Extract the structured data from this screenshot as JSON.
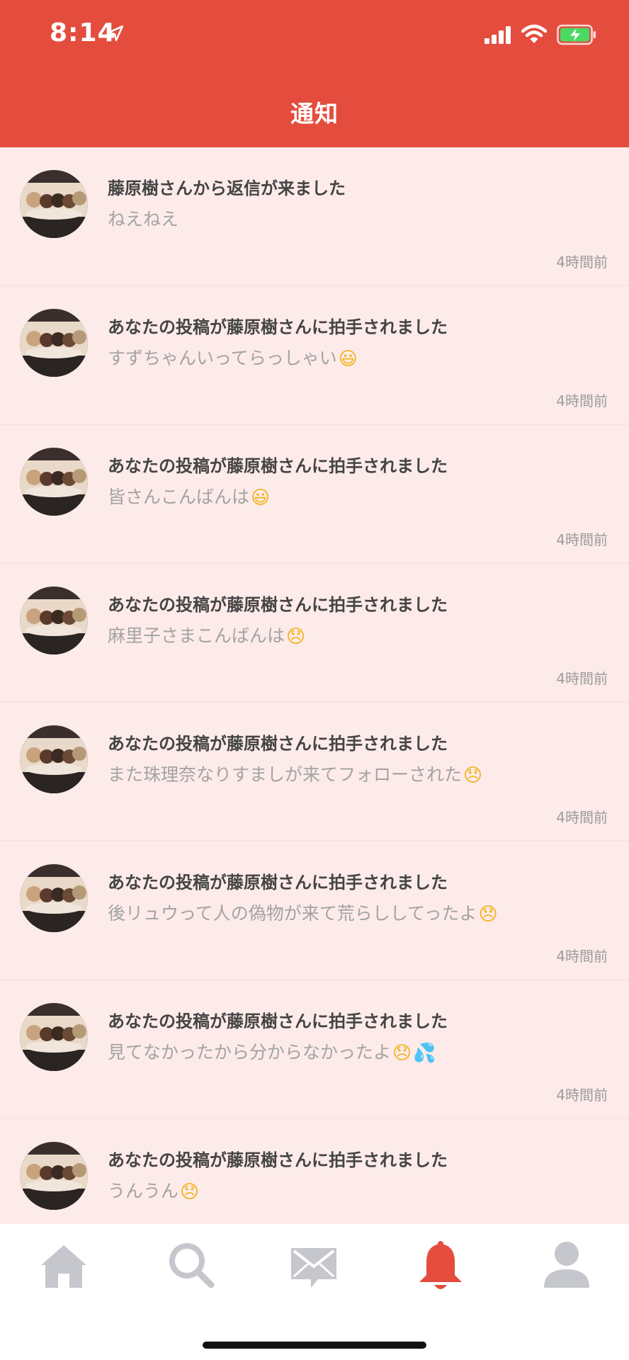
{
  "status_bar": {
    "time": "8:14"
  },
  "header": {
    "title": "通知"
  },
  "notifications": [
    {
      "title": "藤原樹さんから返信が来ました",
      "body": "ねえねえ",
      "emojis": [],
      "time": "4時間前"
    },
    {
      "title": "あなたの投稿が藤原樹さんに拍手されました",
      "body": "すずちゃんいってらっしゃい",
      "emojis": [
        "😃"
      ],
      "time": "4時間前"
    },
    {
      "title": "あなたの投稿が藤原樹さんに拍手されました",
      "body": "皆さんこんばんは",
      "emojis": [
        "😃"
      ],
      "time": "4時間前"
    },
    {
      "title": "あなたの投稿が藤原樹さんに拍手されました",
      "body": "麻里子さまこんばんは",
      "emojis": [
        "😞"
      ],
      "time": "4時間前"
    },
    {
      "title": "あなたの投稿が藤原樹さんに拍手されました",
      "body": "また珠理奈なりすましが来てフォローされた",
      "emojis": [
        "😞"
      ],
      "time": "4時間前"
    },
    {
      "title": "あなたの投稿が藤原樹さんに拍手されました",
      "body": "後リュウって人の偽物が来て荒らししてったよ",
      "emojis": [
        "😞"
      ],
      "time": "4時間前"
    },
    {
      "title": "あなたの投稿が藤原樹さんに拍手されました",
      "body": "見てなかったから分からなかったよ",
      "emojis": [
        "😞",
        "💦"
      ],
      "time": "4時間前"
    },
    {
      "title": "あなたの投稿が藤原樹さんに拍手されました",
      "body": "うんうん",
      "emojis": [
        "😞"
      ],
      "time": ""
    }
  ],
  "tabbar": {
    "tabs": [
      {
        "icon": "home-icon",
        "active": false
      },
      {
        "icon": "search-icon",
        "active": false
      },
      {
        "icon": "mail-icon",
        "active": false
      },
      {
        "icon": "bell-icon",
        "active": true
      },
      {
        "icon": "profile-icon",
        "active": false
      }
    ]
  },
  "colors": {
    "header": "#e44d3e",
    "list_bg": "#fdebea",
    "tab_active": "#e44d3e",
    "tab_inactive": "#c5c7cc"
  }
}
